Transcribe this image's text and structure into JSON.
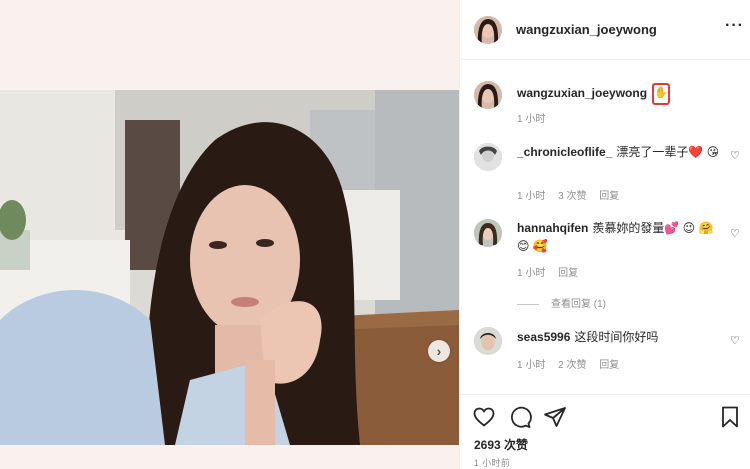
{
  "post": {
    "username": "wangzuxian_joeywong",
    "more_icon": "more-options-icon",
    "caption_emoji": "✋",
    "caption_time": "1 小时"
  },
  "comments": [
    {
      "username": "_chronicleoflife_",
      "text": "漂亮了一辈子❤️ 😘",
      "time": "1 小时",
      "likes": "3 次赞",
      "reply": "回复"
    },
    {
      "username": "hannahqifen",
      "text": "羨慕妳的發量💕 😉 🤗 😊 🥰",
      "time": "1 小时",
      "reply": "回复",
      "view_replies": "查看回复 (1)"
    },
    {
      "username": "seas5996",
      "text": "这段时间你好吗",
      "time": "1 小时",
      "likes": "2 次赞",
      "reply": "回复"
    }
  ],
  "footer": {
    "likes_count": "2693 次赞",
    "posted_time": "1 小时前"
  },
  "colors": {
    "text": "#262626",
    "meta": "#8e8e8e",
    "divider": "#efefef",
    "highlight": "#e53935"
  }
}
